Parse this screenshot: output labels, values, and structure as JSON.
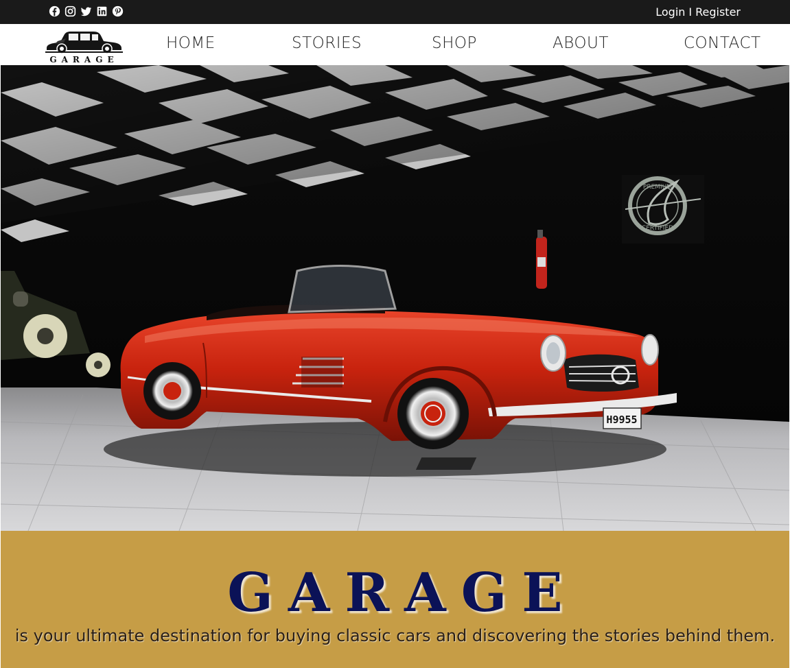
{
  "topbar": {
    "social_icons": [
      "facebook-icon",
      "instagram-icon",
      "twitter-icon",
      "linkedin-icon",
      "pinterest-icon"
    ],
    "login": "Login",
    "separator": "I",
    "register": "Register"
  },
  "nav": {
    "logo_text": "GARAGE",
    "items": [
      "HOME",
      "STORIES",
      "SHOP",
      "ABOUT",
      "CONTACT"
    ]
  },
  "hero": {
    "plate": "H9955",
    "sign_top": "PREMIUM",
    "sign_bottom": "CERTIFIED"
  },
  "banner": {
    "title": "GARAGE",
    "tagline": "is your ultimate destination for buying classic cars and discovering the stories behind them."
  },
  "colors": {
    "topbar": "#1a1a1a",
    "banner": "#c69d46",
    "brand": "#0b1257",
    "car": "#c8230e"
  }
}
